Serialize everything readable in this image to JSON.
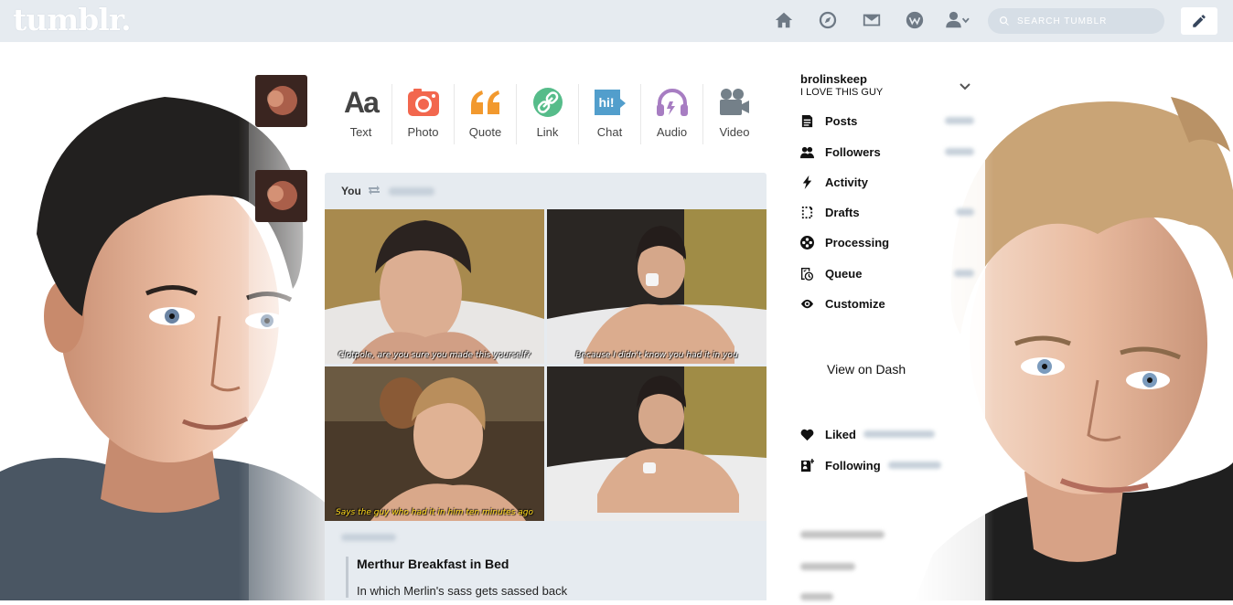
{
  "app": {
    "logo": "tumblr."
  },
  "nav": {
    "items": [
      {
        "name": "home-icon"
      },
      {
        "name": "explore-icon"
      },
      {
        "name": "inbox-icon"
      },
      {
        "name": "activity-icon"
      },
      {
        "name": "account-icon"
      }
    ],
    "search_placeholder": "SEARCH TUMBLR",
    "compose": {
      "icon": "pencil-icon"
    }
  },
  "post_types": [
    {
      "label": "Text",
      "icon": "text-icon",
      "color": "#444444"
    },
    {
      "label": "Photo",
      "icon": "camera-icon",
      "color": "#f2674e"
    },
    {
      "label": "Quote",
      "icon": "quote-icon",
      "color": "#f2992e"
    },
    {
      "label": "Link",
      "icon": "link-icon",
      "color": "#56bc8a"
    },
    {
      "label": "Chat",
      "icon": "chat-icon",
      "color": "#529ecc"
    },
    {
      "label": "Audio",
      "icon": "headphones-icon",
      "color": "#a77dc2"
    },
    {
      "label": "Video",
      "icon": "video-camera-icon",
      "color": "#748089"
    }
  ],
  "post": {
    "author": "You",
    "photos": [
      {
        "caption": "Clotpole, are you sure you made this yourself?",
        "caption_color": "white"
      },
      {
        "caption": "Because I didn't know you had it in you",
        "caption_color": "white"
      },
      {
        "caption": "Says the guy who had it in him ten minutes ago",
        "caption_color": "yellow"
      },
      {
        "caption": "",
        "caption_color": "white"
      }
    ],
    "quote_title": "Merthur Breakfast in Bed",
    "quote_text": "In which Merlin's sass gets sassed back"
  },
  "sidebar": {
    "blog_name": "brolinskeep",
    "blog_title": "I LOVE THIS GUY",
    "menu": [
      {
        "label": "Posts",
        "icon": "posts-icon"
      },
      {
        "label": "Followers",
        "icon": "followers-icon"
      },
      {
        "label": "Activity",
        "icon": "lightning-icon"
      },
      {
        "label": "Drafts",
        "icon": "drafts-icon"
      },
      {
        "label": "Processing",
        "icon": "processing-icon"
      },
      {
        "label": "Queue",
        "icon": "queue-icon"
      },
      {
        "label": "Customize",
        "icon": "eye-icon"
      }
    ],
    "view_on_dash": "View on Dash",
    "liked_label": "Liked",
    "following_label": "Following"
  },
  "colors": {
    "topbar": "#e6ebf0",
    "post_bg": "#e6ebf0",
    "text_dark": "#111111"
  }
}
